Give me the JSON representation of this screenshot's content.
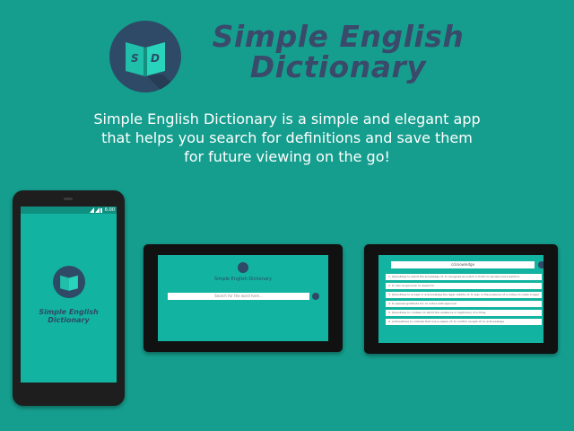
{
  "header": {
    "title_line1": "Simple English",
    "title_line2": "Dictionary",
    "logo_letters": [
      "S",
      "D"
    ],
    "tagline_lines": [
      "Simple English Dictionary is a simple and elegant app",
      "that helps you search for definitions and save them",
      "for future viewing on the go!"
    ]
  },
  "phone": {
    "status_time": "6:00",
    "app_title": "Simple English Dictionary",
    "nav": {
      "back": "◁",
      "home": "○",
      "recent": "□"
    }
  },
  "tablet1": {
    "app_title": "Simple English Dictionary",
    "search_placeholder": "Search for the word here..."
  },
  "tablet2": {
    "search_value": "ccknowledge",
    "definitions": [
      "1. (transitive) to admit the knowledge of; to recognize as a fact or truth; to declare one's belief in",
      "2. to own as genuine; to assent to",
      "3. (transitive) to accept or acknowledge the legal validity of; to sign in the presence of a notary to make a legal",
      "4. to express gratitude for; to notice with approval",
      "5. (transitive) to confess; to admit the existence or legitimacy of a thing",
      "6. (intransitive) to indicate that one is aware of; to confirm receipt of; to acknowledge"
    ]
  },
  "colors": {
    "background": "#159e8e",
    "screen": "#12b3a0",
    "navy": "#2e4a66",
    "title_text": "#3a4a6a"
  }
}
